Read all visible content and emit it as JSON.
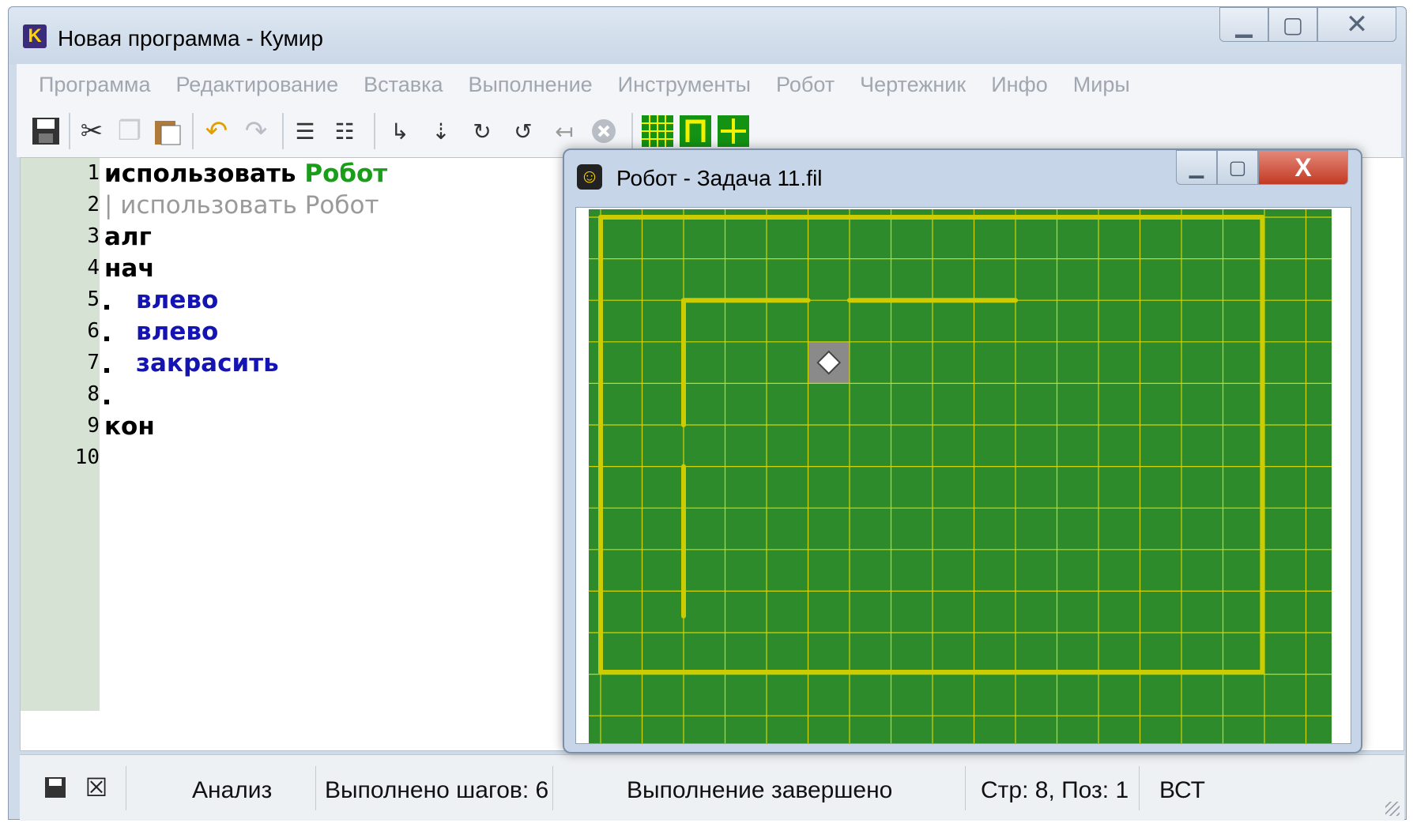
{
  "app": {
    "icon_letter": "K",
    "title": "Новая программа - Кумир"
  },
  "menu": [
    "Программа",
    "Редактирование",
    "Вставка",
    "Выполнение",
    "Инструменты",
    "Робот",
    "Чертежник",
    "Инфо",
    "Миры"
  ],
  "toolbar_icons": [
    "save-icon",
    "cut-icon",
    "copy-icon",
    "paste-icon",
    "undo-icon",
    "redo-icon",
    "indent-icon",
    "unindent-icon",
    "step-in-icon",
    "step-over-icon",
    "step-into-icon",
    "step-out-icon",
    "step-back-icon",
    "stop-icon",
    "robot-grid-icon",
    "robot-pi-icon",
    "drawer-cross-icon"
  ],
  "code_lines": [
    {
      "no": "1"
    },
    {
      "no": "2"
    },
    {
      "no": "3"
    },
    {
      "no": "4"
    },
    {
      "no": "5"
    },
    {
      "no": "6"
    },
    {
      "no": "7"
    },
    {
      "no": "8"
    },
    {
      "no": "9"
    },
    {
      "no": "10"
    }
  ],
  "code": {
    "line1_kw": "использовать",
    "line1_mod": "Робот",
    "line2": "| использовать Робот",
    "line3": "алг",
    "line4": "нач",
    "line5": "влево",
    "line6": "влево",
    "line7": "закрасить",
    "line9": "кон"
  },
  "statusbar": {
    "mode": "Анализ",
    "steps": "Выполнено шагов: 6",
    "state": "Выполнение завершено",
    "position": "Стр: 8, Поз: 1",
    "insert_mode": "ВСТ"
  },
  "robot_window": {
    "title": "Робот - Задача 11.fil",
    "field_colors": {
      "background": "#2e8b2b",
      "grid": "#d4d400",
      "wall": "#cccc00",
      "painted_cell": "#8a8a8a"
    },
    "grid_cols": 16,
    "grid_rows": 11,
    "robot_cell": [
      5,
      3
    ]
  }
}
